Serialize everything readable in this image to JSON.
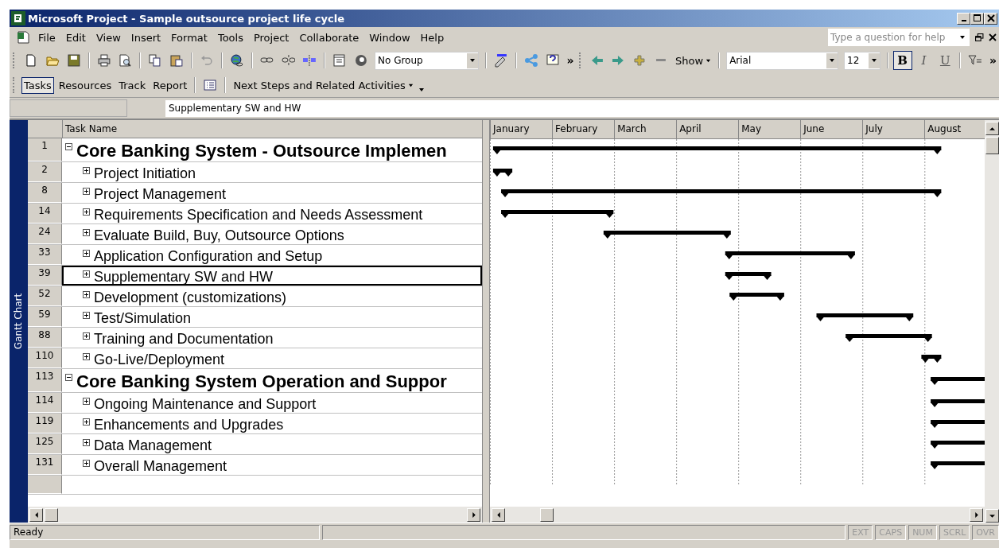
{
  "window": {
    "title": "Microsoft Project - Sample outsource project life cycle"
  },
  "menu": [
    "File",
    "Edit",
    "View",
    "Insert",
    "Format",
    "Tools",
    "Project",
    "Collaborate",
    "Window",
    "Help"
  ],
  "help_search": {
    "placeholder": "Type a question for help"
  },
  "toolbar": {
    "group_select": "No Group",
    "overflow": [
      "»",
      "»"
    ],
    "show_menu": "Show",
    "font": "Arial",
    "font_size": "12",
    "format_buttons": [
      {
        "label": "B",
        "selected": true
      },
      {
        "label": "I",
        "selected": false
      },
      {
        "label": "U",
        "selected": false
      }
    ]
  },
  "guide_toolbar": {
    "buttons": [
      {
        "label": "Tasks",
        "selected": true
      },
      {
        "label": "Resources",
        "selected": false
      },
      {
        "label": "Track",
        "selected": false
      },
      {
        "label": "Report",
        "selected": false
      }
    ],
    "next_steps": "Next Steps and Related Activities"
  },
  "entry_bar": {
    "value": "Supplementary SW and HW"
  },
  "view_bar": {
    "label": "Gantt Chart"
  },
  "table": {
    "column": "Task Name",
    "tasks": [
      {
        "id": "1",
        "name": "Core Banking System - Outsource Implemen",
        "expanded": true,
        "selected": false,
        "children": [
          {
            "id": "2",
            "name": "Project Initiation",
            "expanded": false,
            "selected": false
          },
          {
            "id": "8",
            "name": "Project Management",
            "expanded": false,
            "selected": false
          },
          {
            "id": "14",
            "name": "Requirements Specification and Needs Assessment",
            "expanded": false,
            "selected": false
          },
          {
            "id": "24",
            "name": "Evaluate Build, Buy, Outsource Options",
            "expanded": false,
            "selected": false
          },
          {
            "id": "33",
            "name": "Application Configuration and Setup",
            "expanded": false,
            "selected": false
          },
          {
            "id": "39",
            "name": "Supplementary SW and HW",
            "expanded": false,
            "selected": true
          },
          {
            "id": "52",
            "name": "Development (customizations)",
            "expanded": false,
            "selected": false
          },
          {
            "id": "59",
            "name": "Test/Simulation",
            "expanded": false,
            "selected": false
          },
          {
            "id": "88",
            "name": "Training and Documentation",
            "expanded": false,
            "selected": false
          },
          {
            "id": "110",
            "name": "Go-Live/Deployment",
            "expanded": false,
            "selected": false
          }
        ]
      },
      {
        "id": "113",
        "name": "Core Banking System Operation and Suppor",
        "expanded": true,
        "selected": false,
        "children": [
          {
            "id": "114",
            "name": "Ongoing Maintenance and Support",
            "expanded": false,
            "selected": false
          },
          {
            "id": "119",
            "name": "Enhancements and Upgrades",
            "expanded": false,
            "selected": false
          },
          {
            "id": "125",
            "name": "Data Management",
            "expanded": false,
            "selected": false
          },
          {
            "id": "131",
            "name": "Overall Management",
            "expanded": false,
            "selected": false
          }
        ]
      }
    ]
  },
  "gantt": {
    "months": [
      "January",
      "February",
      "March",
      "April",
      "May",
      "June",
      "July",
      "August"
    ]
  },
  "status_bar": {
    "status": "Ready",
    "indicators": [
      {
        "label": "EXT",
        "on": false
      },
      {
        "label": "CAPS",
        "on": false
      },
      {
        "label": "NUM",
        "on": false
      },
      {
        "label": "SCRL",
        "on": false
      },
      {
        "label": "OVR",
        "on": false
      }
    ]
  }
}
